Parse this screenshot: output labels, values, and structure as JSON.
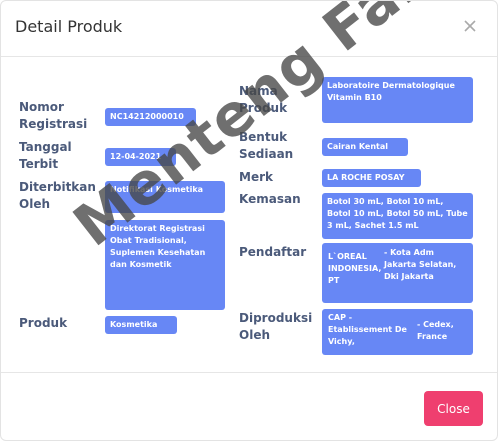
{
  "modal": {
    "title": "Detail Produk",
    "close_button": "Close"
  },
  "fields_left": [
    {
      "label": "Nomor Registrasi",
      "value": "NC14212000010"
    },
    {
      "label": "Tanggal Terbit",
      "value": "12-04-2021"
    },
    {
      "label": "Diterbitkan Oleh",
      "value": "Notifikasi Kosmetika"
    },
    {
      "label": "",
      "value": "Direktorat Registrasi Obat Tradisional, Suplemen Kesehatan dan Kosmetik"
    },
    {
      "label": "Produk",
      "value": "Kosmetika"
    }
  ],
  "fields_right": [
    {
      "label": "Nama Produk",
      "value": "Laboratoire Dermatologique Vitamin B10"
    },
    {
      "label": "Bentuk Sediaan",
      "value": "Cairan Kental"
    },
    {
      "label": "Merk",
      "value": "LA ROCHE POSAY"
    },
    {
      "label": "Kemasan",
      "value": "Botol 30 mL, Botol 10 mL, Botol 10 mL, Botol 50 mL, Tube 3 mL, Sachet 1.5 mL"
    },
    {
      "label": "Pendaftar",
      "value_left": "L`OREAL INDONESIA, PT",
      "value_right": "- Kota Adm Jakarta Selatan, Dki Jakarta"
    },
    {
      "label": "Diproduksi Oleh",
      "value_left": "CAP - Etablissement De Vichy,",
      "value_right": "- Cedex, France"
    }
  ],
  "watermark": "Menteng Farma",
  "colors": {
    "badge": "#6787f5",
    "label": "#4b5a7a",
    "close_button": "#ef3f6f"
  }
}
